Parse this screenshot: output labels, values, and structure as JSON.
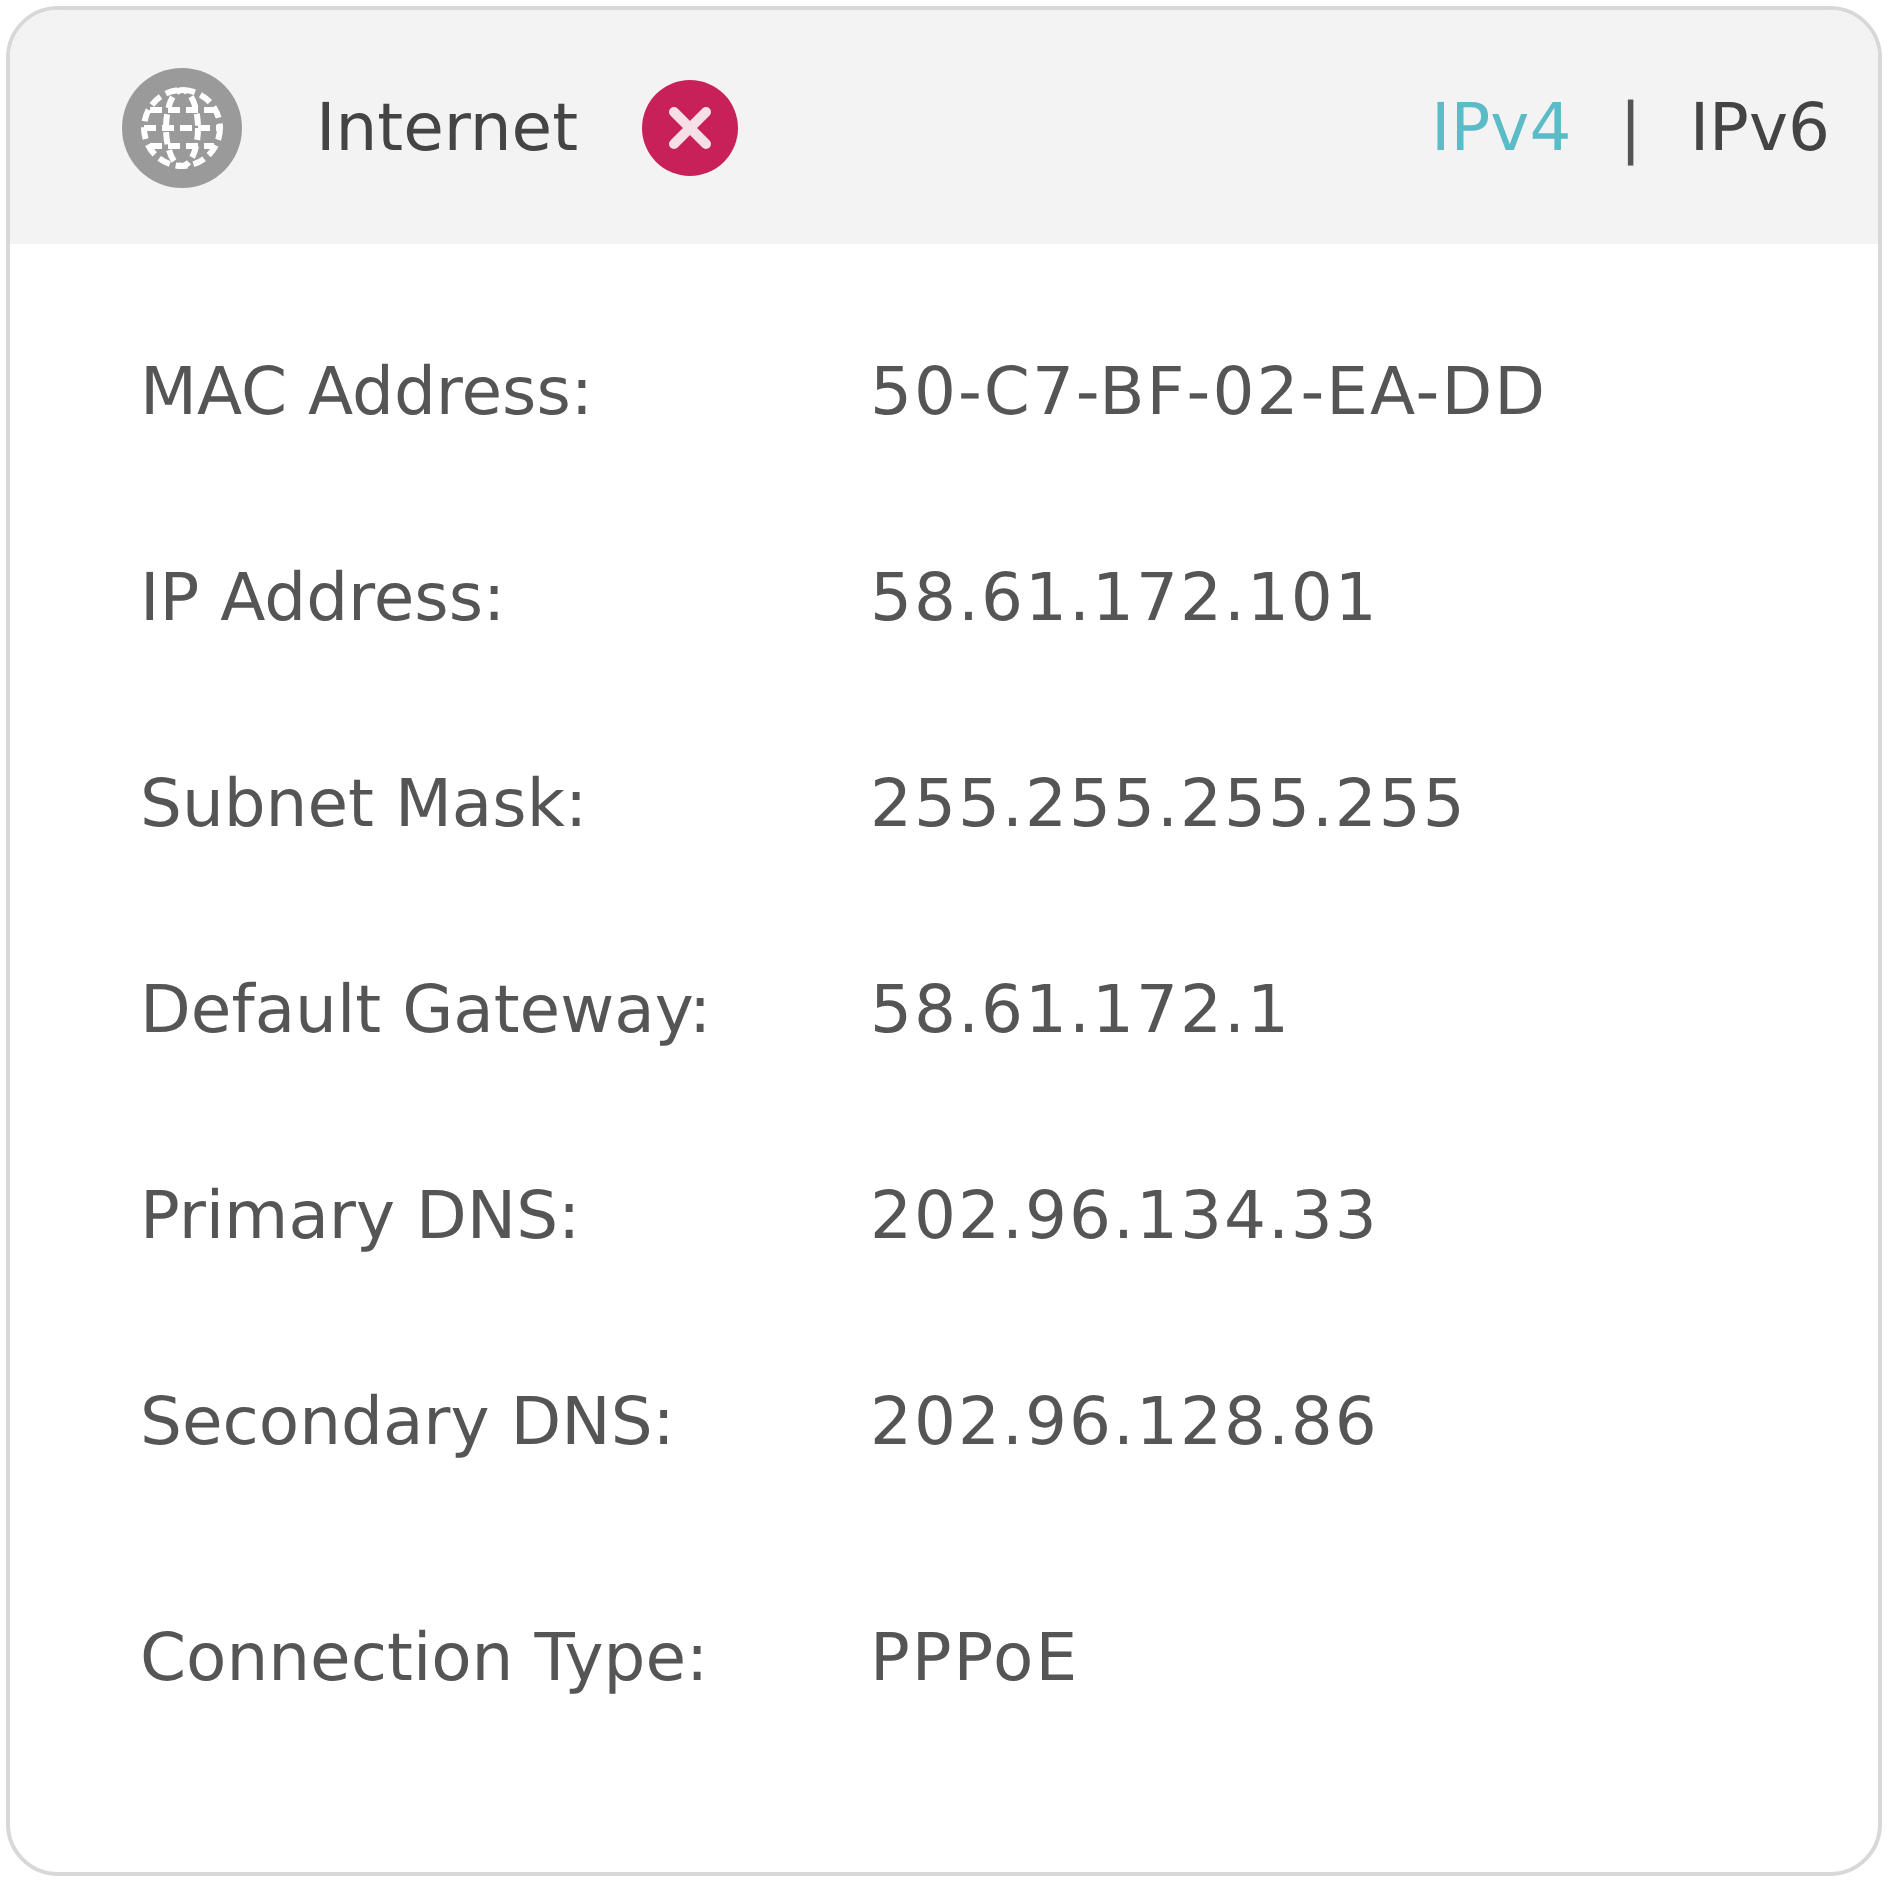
{
  "header": {
    "title": "Internet",
    "connected": false,
    "tabs": [
      {
        "label": "IPv4",
        "selected": true
      },
      {
        "label": "IPv6",
        "selected": false
      }
    ],
    "separator": "|"
  },
  "rows": [
    {
      "label": "MAC Address:",
      "value": "50-C7-BF-02-EA-DD"
    },
    {
      "label": "IP Address:",
      "value": "58.61.172.101"
    },
    {
      "label": "Subnet Mask:",
      "value": "255.255.255.255"
    },
    {
      "label": "Default Gateway:",
      "value": "58.61.172.1"
    },
    {
      "label": "Primary DNS:",
      "value": "202.96.134.33"
    },
    {
      "label": "Secondary DNS:",
      "value": "202.96.128.86"
    },
    {
      "label": "Connection Type:",
      "value": "PPPoE"
    }
  ]
}
